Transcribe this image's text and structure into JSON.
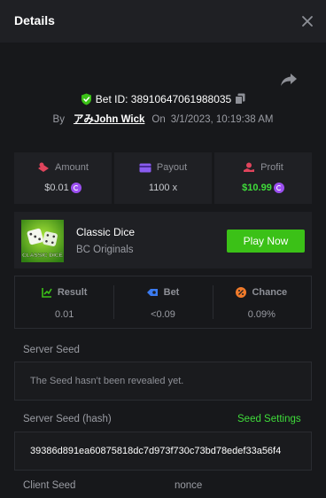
{
  "header": {
    "title": "Details"
  },
  "bet": {
    "id_text": "Bet ID: 38910647061988035",
    "by_label": "By",
    "user": "アみJohn Wick",
    "on_label": "On",
    "datetime": "3/1/2023, 10:19:38 AM"
  },
  "stats": {
    "amount_label": "Amount",
    "amount_value": "$0.01",
    "payout_label": "Payout",
    "payout_value": "1100 x",
    "profit_label": "Profit",
    "profit_value": "$10.99"
  },
  "game": {
    "name": "Classic Dice",
    "provider": "BC Originals",
    "thumb_text": "CLASSIC DICE",
    "play_label": "Play Now"
  },
  "result": {
    "result_label": "Result",
    "result_value": "0.01",
    "bet_label": "Bet",
    "bet_value": "<0.09",
    "chance_label": "Chance",
    "chance_value": "0.09%"
  },
  "seeds": {
    "server_seed_label": "Server Seed",
    "server_seed_value": "The Seed hasn't been revealed yet.",
    "server_hash_label": "Server Seed (hash)",
    "seed_settings_label": "Seed Settings",
    "server_hash_value": "39386d891ea60875818dc7d973f730c73bd78edef33a56f4",
    "client_seed_label": "Client Seed",
    "nonce_label": "nonce"
  },
  "colors": {
    "accent_green": "#3bc117",
    "profit_green": "#3fdc3a",
    "coin_purple": "#9b4ff0"
  }
}
